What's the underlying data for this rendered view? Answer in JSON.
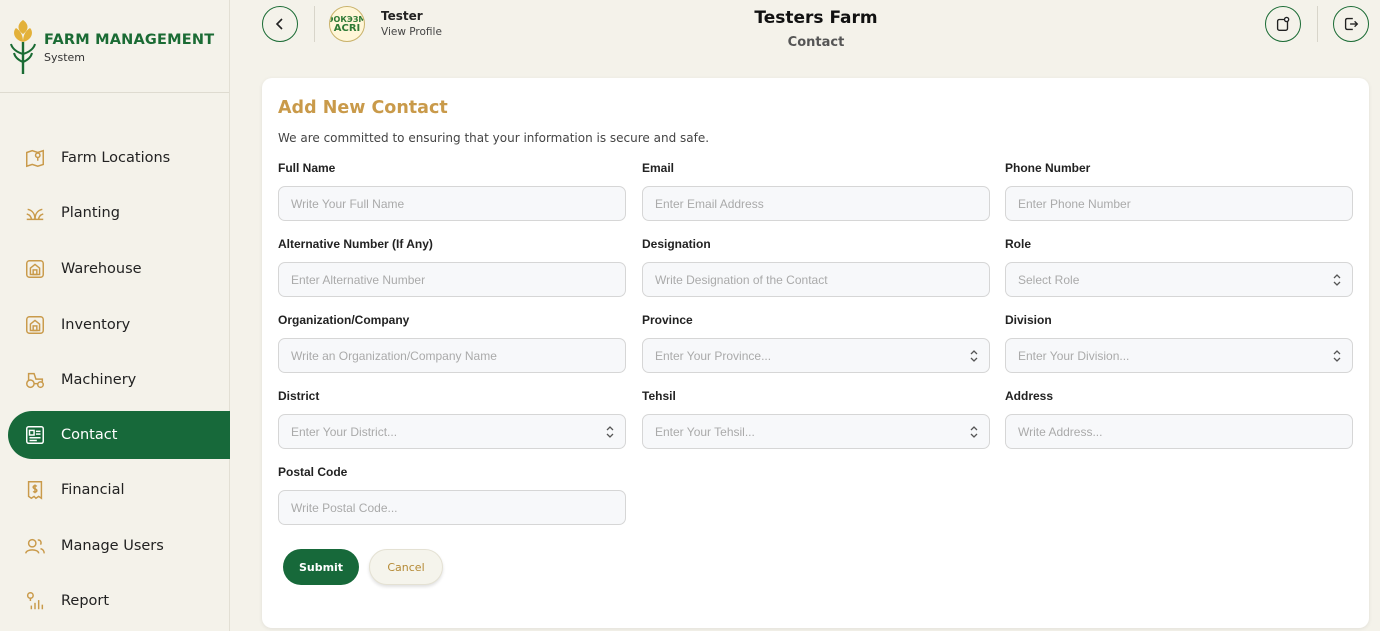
{
  "brand": {
    "title": "FARM MANAGEMENT",
    "subtitle": "System"
  },
  "sidebar": {
    "items": [
      {
        "label": "Farm Locations",
        "icon": "map-icon"
      },
      {
        "label": "Planting",
        "icon": "sprout-icon"
      },
      {
        "label": "Warehouse",
        "icon": "warehouse-icon"
      },
      {
        "label": "Inventory",
        "icon": "inventory-icon"
      },
      {
        "label": "Machinery",
        "icon": "tractor-icon"
      },
      {
        "label": "Contact",
        "icon": "contact-book-icon",
        "active": true
      },
      {
        "label": "Financial",
        "icon": "receipt-dollar-icon"
      },
      {
        "label": "Manage Users",
        "icon": "users-icon"
      },
      {
        "label": "Report",
        "icon": "chart-pin-icon"
      }
    ]
  },
  "header": {
    "user_name": "Tester",
    "view_profile": "View Profile",
    "avatar_text_top": "ЭОКЭЗМ",
    "avatar_text_bottom": "ACRI",
    "farm_title": "Testers Farm",
    "page_subtitle": "Contact"
  },
  "form": {
    "title": "Add New Contact",
    "subtitle": "We are committed to ensuring that your information is secure and safe.",
    "fields": [
      {
        "label": "Full Name",
        "placeholder": "Write Your Full Name",
        "type": "text"
      },
      {
        "label": "Email",
        "placeholder": "Enter Email Address",
        "type": "text"
      },
      {
        "label": "Phone Number",
        "placeholder": "Enter Phone Number",
        "type": "text"
      },
      {
        "label": "Alternative Number (If Any)",
        "placeholder": "Enter Alternative Number",
        "type": "text"
      },
      {
        "label": "Designation",
        "placeholder": "Write Designation of the Contact",
        "type": "text"
      },
      {
        "label": "Role",
        "placeholder": "Select Role",
        "type": "select"
      },
      {
        "label": "Organization/Company",
        "placeholder": "Write an Organization/Company Name",
        "type": "text"
      },
      {
        "label": "Province",
        "placeholder": "Enter Your Province...",
        "type": "select"
      },
      {
        "label": "Division",
        "placeholder": "Enter Your Division...",
        "type": "select"
      },
      {
        "label": "District",
        "placeholder": "Enter Your District...",
        "type": "select"
      },
      {
        "label": "Tehsil",
        "placeholder": "Enter Your Tehsil...",
        "type": "select"
      },
      {
        "label": "Address",
        "placeholder": "Write Address...",
        "type": "text"
      },
      {
        "label": "Postal Code",
        "placeholder": "Write Postal Code...",
        "type": "text"
      }
    ],
    "submit_label": "Submit",
    "cancel_label": "Cancel"
  },
  "colors": {
    "brand_green": "#17693a",
    "accent_gold": "#c99a4a",
    "background": "#f4f2ea"
  }
}
